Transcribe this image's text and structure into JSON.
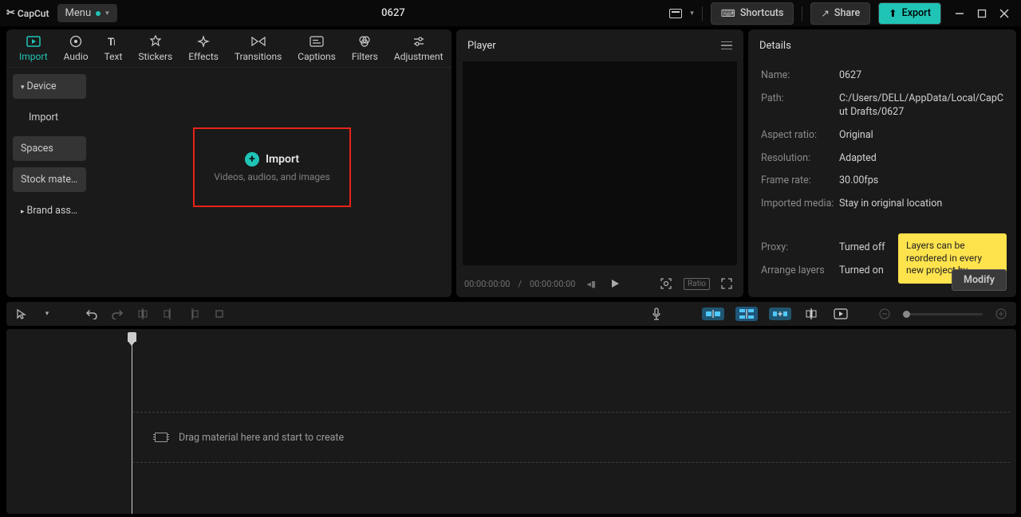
{
  "titlebar": {
    "app_name": "CapCut",
    "menu_label": "Menu",
    "project_title": "0627",
    "shortcuts_label": "Shortcuts",
    "share_label": "Share",
    "export_label": "Export"
  },
  "media_tabs": [
    {
      "id": "import",
      "label": "Import"
    },
    {
      "id": "audio",
      "label": "Audio"
    },
    {
      "id": "text",
      "label": "Text"
    },
    {
      "id": "stickers",
      "label": "Stickers"
    },
    {
      "id": "effects",
      "label": "Effects"
    },
    {
      "id": "transitions",
      "label": "Transitions"
    },
    {
      "id": "captions",
      "label": "Captions"
    },
    {
      "id": "filters",
      "label": "Filters"
    },
    {
      "id": "adjustment",
      "label": "Adjustment"
    }
  ],
  "media_side": {
    "device": "Device",
    "import": "Import",
    "spaces": "Spaces",
    "stock": "Stock mate...",
    "brand": "Brand assets"
  },
  "import_box": {
    "title": "Import",
    "subtitle": "Videos, audios, and images"
  },
  "player": {
    "title": "Player",
    "time_current": "00:00:00:00",
    "time_total": "00:00:00:00",
    "ratio_label": "Ratio"
  },
  "details": {
    "title": "Details",
    "rows": {
      "name": {
        "label": "Name:",
        "value": "0627"
      },
      "path": {
        "label": "Path:",
        "value": "C:/Users/DELL/AppData/Local/CapCut Drafts/0627"
      },
      "aspect": {
        "label": "Aspect ratio:",
        "value": "Original"
      },
      "resolution": {
        "label": "Resolution:",
        "value": "Adapted"
      },
      "framerate": {
        "label": "Frame rate:",
        "value": "30.00fps"
      },
      "imported": {
        "label": "Imported media:",
        "value": "Stay in original location"
      },
      "proxy": {
        "label": "Proxy:",
        "value": "Turned off"
      },
      "layers": {
        "label": "Arrange layers",
        "value": "Turned on"
      }
    },
    "tooltip_text": "Layers can be reordered in every new project by",
    "modify_label": "Modify"
  },
  "timeline": {
    "drag_hint": "Drag material here and start to create"
  }
}
